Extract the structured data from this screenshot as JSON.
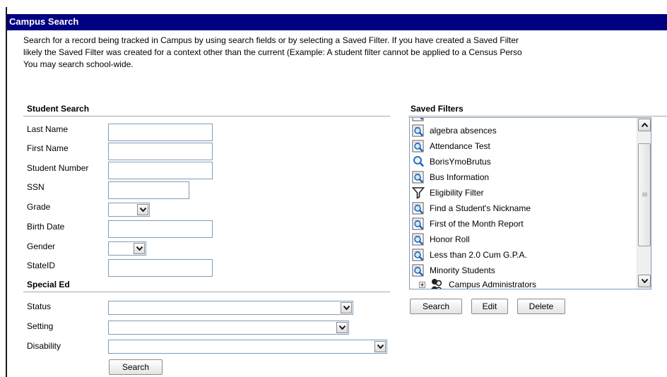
{
  "title": "Campus Search",
  "intro": [
    "Search for a record being tracked in Campus by using search fields or by selecting a Saved Filter. If you have created a Saved Filter",
    "likely the Saved Filter was created for a context other than the current (Example: A student filter cannot be applied to a Census Perso",
    "You may search school-wide."
  ],
  "student_search": {
    "heading": "Student Search",
    "fields": {
      "last_name": "Last Name",
      "first_name": "First Name",
      "student_number": "Student Number",
      "ssn": "SSN",
      "grade": "Grade",
      "birth_date": "Birth Date",
      "gender": "Gender",
      "state_id": "StateID"
    }
  },
  "special_ed": {
    "heading": "Special Ed",
    "fields": {
      "status": "Status",
      "setting": "Setting",
      "disability": "Disability"
    }
  },
  "search_button": "Search",
  "saved_filters": {
    "heading": "Saved Filters",
    "items": [
      {
        "label": "algebra absences",
        "icon": "search-filter-icon"
      },
      {
        "label": "Attendance Test",
        "icon": "search-filter-icon"
      },
      {
        "label": "BorisYmoBrutus",
        "icon": "magnifier-icon"
      },
      {
        "label": "Bus Information",
        "icon": "search-filter-icon"
      },
      {
        "label": "Eligibility Filter",
        "icon": "funnel-icon"
      },
      {
        "label": "Find a Student's Nickname",
        "icon": "search-filter-icon"
      },
      {
        "label": "First of the Month Report",
        "icon": "search-filter-icon"
      },
      {
        "label": "Honor Roll",
        "icon": "search-filter-icon"
      },
      {
        "label": "Less than 2.0 Cum G.P.A.",
        "icon": "search-filter-icon"
      },
      {
        "label": "Minority Students",
        "icon": "search-filter-icon"
      }
    ],
    "group": {
      "label": "Campus Administrators",
      "icon": "user-group-icon"
    },
    "buttons": {
      "search": "Search",
      "edit": "Edit",
      "delete": "Delete"
    }
  },
  "colors": {
    "title_bar": "#000080",
    "input_border": "#7f9db9"
  }
}
